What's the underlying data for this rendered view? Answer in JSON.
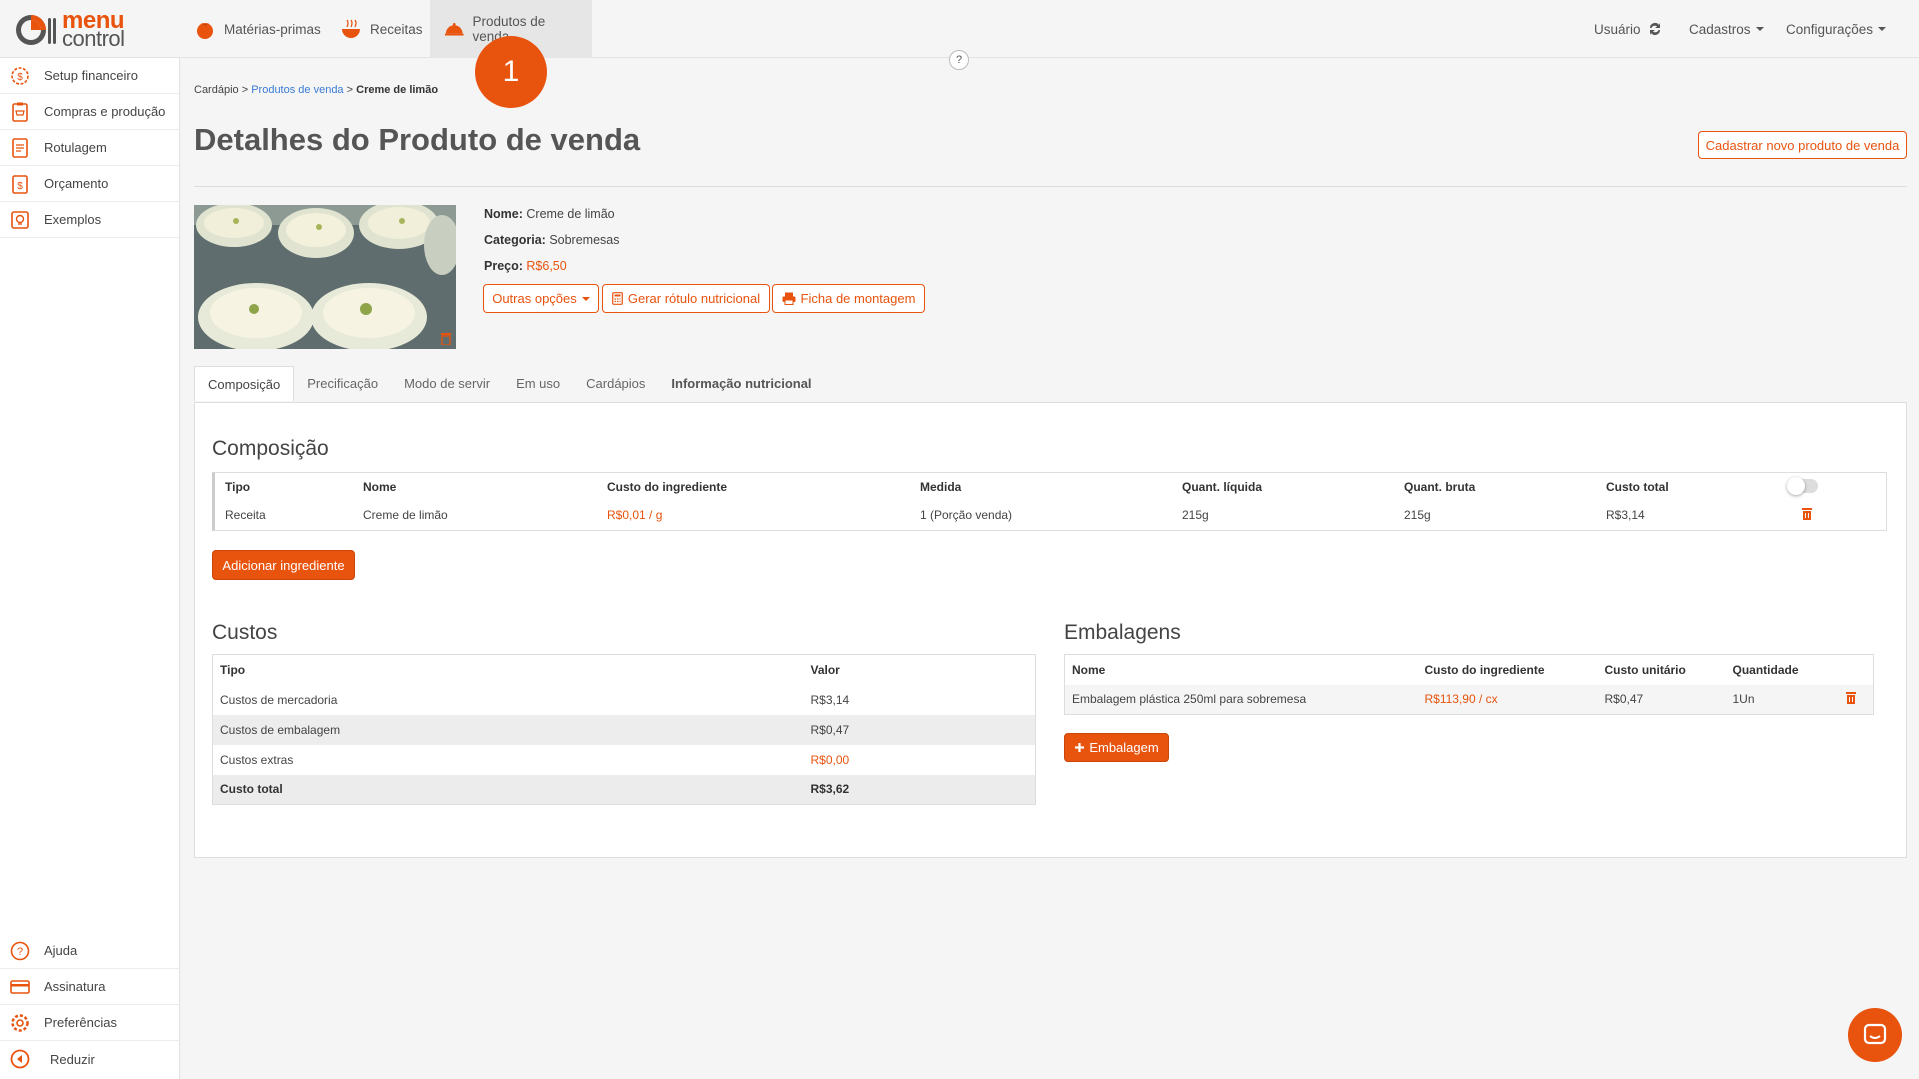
{
  "brand": {
    "line1": "menu",
    "line2": "control",
    "accent": "#e8530e"
  },
  "topnav": {
    "tabs": [
      {
        "label": "Matérias-primas",
        "icon": "tomato-icon"
      },
      {
        "label": "Receitas",
        "icon": "bowl-icon"
      },
      {
        "label": "Produtos de venda",
        "icon": "cloche-icon"
      }
    ],
    "usuario": "Usuário",
    "cadastros": "Cadastros",
    "configuracoes": "Configurações"
  },
  "step_badge": "1",
  "help_label": "?",
  "sidebar": {
    "items": [
      {
        "label": "Setup financeiro",
        "icon": "gear-dollar-icon"
      },
      {
        "label": "Compras e produção",
        "icon": "clipboard-cart-icon"
      },
      {
        "label": "Rotulagem",
        "icon": "label-icon"
      },
      {
        "label": "Orçamento",
        "icon": "budget-icon"
      },
      {
        "label": "Exemplos",
        "icon": "lightbulb-icon"
      }
    ],
    "bottom": [
      {
        "label": "Ajuda",
        "icon": "help-circle-icon"
      },
      {
        "label": "Assinatura",
        "icon": "credit-card-icon"
      },
      {
        "label": "Preferências",
        "icon": "gear-icon"
      },
      {
        "label": "Reduzir",
        "icon": "collapse-left-icon"
      }
    ]
  },
  "breadcrumb": {
    "root": "Cardápio",
    "sep": ">",
    "section": "Produtos de venda",
    "current": "Creme de limão"
  },
  "page_title": "Detalhes do Produto de venda",
  "new_button": "Cadastrar novo produto de venda",
  "product": {
    "name_label": "Nome:",
    "name": "Creme de limão",
    "category_label": "Categoria:",
    "category": "Sobremesas",
    "price_label": "Preço:",
    "price": "R$6,50"
  },
  "actions": {
    "outras": "Outras opções",
    "rotulo": "Gerar rótulo nutricional",
    "ficha": "Ficha de montagem"
  },
  "tabs": [
    "Composição",
    "Precificação",
    "Modo de servir",
    "Em uso",
    "Cardápios",
    "Informação nutricional"
  ],
  "composicao": {
    "title": "Composição",
    "headers": [
      "Tipo",
      "Nome",
      "Custo do ingrediente",
      "Medida",
      "Quant. líquida",
      "Quant. bruta",
      "Custo total"
    ],
    "rows": [
      {
        "tipo": "Receita",
        "nome": "Creme de limão",
        "custo": "R$0,01 / g",
        "medida": "1 (Porção venda)",
        "liquida": "215g",
        "bruta": "215g",
        "total": "R$3,14"
      }
    ],
    "add_button": "Adicionar ingrediente"
  },
  "custos": {
    "title": "Custos",
    "headers": [
      "Tipo",
      "Valor"
    ],
    "rows": [
      {
        "tipo": "Custos de mercadoria",
        "valor": "R$3,14"
      },
      {
        "tipo": "Custos de embalagem",
        "valor": "R$0,47"
      },
      {
        "tipo": "Custos extras",
        "valor": "R$0,00"
      }
    ],
    "total_label": "Custo total",
    "total_value": "R$3,62"
  },
  "embalagens": {
    "title": "Embalagens",
    "headers": [
      "Nome",
      "Custo do ingrediente",
      "Custo unitário",
      "Quantidade"
    ],
    "rows": [
      {
        "nome": "Embalagem plástica 250ml para sobremesa",
        "custo": "R$113,90 / cx",
        "unitario": "R$0,47",
        "quantidade": "1Un"
      }
    ],
    "add_button": "Embalagem"
  }
}
